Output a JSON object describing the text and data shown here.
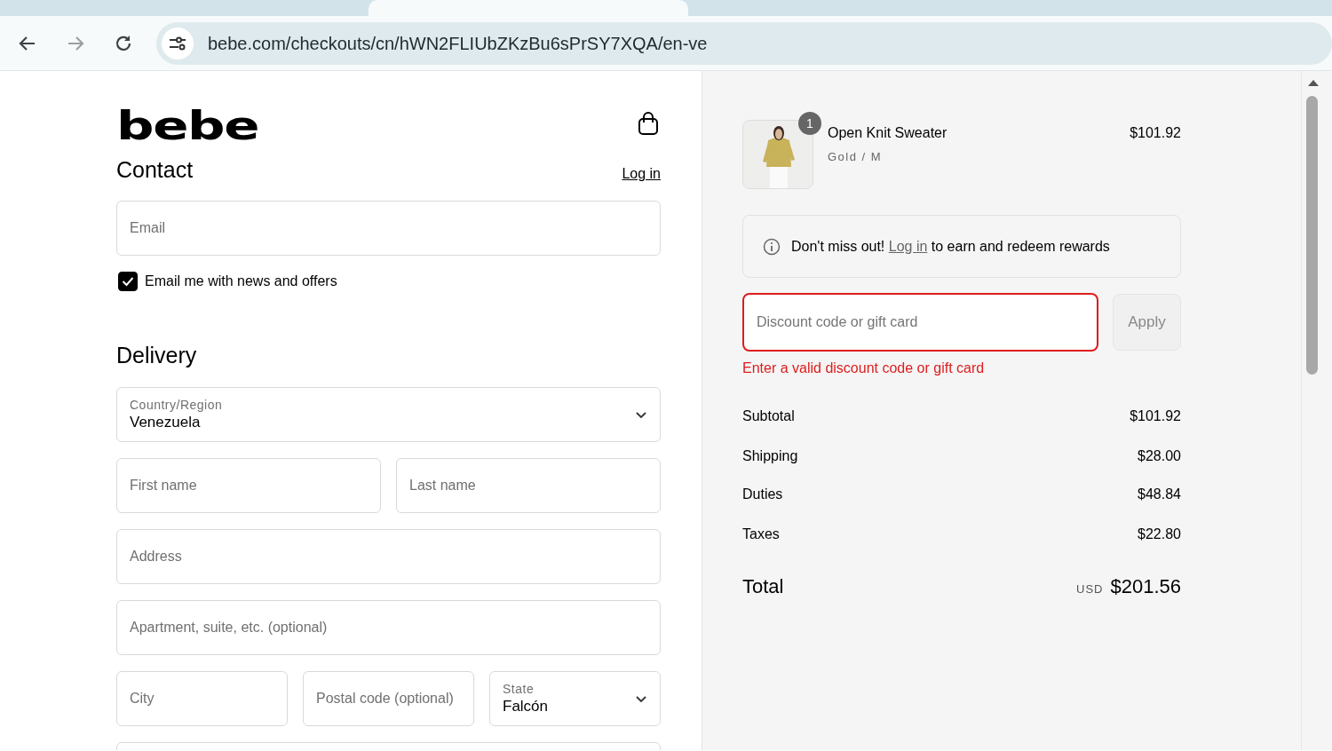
{
  "browser": {
    "url": "bebe.com/checkouts/cn/hWN2FLIUbZKzBu6sPrSY7XQA/en-ve",
    "forward_disabled": true
  },
  "header": {
    "logo": "bebe"
  },
  "contact": {
    "title": "Contact",
    "login_link": "Log in",
    "email": {
      "placeholder": "Email"
    },
    "newsletter": {
      "label": "Email me with news and offers",
      "checked": true
    }
  },
  "delivery": {
    "title": "Delivery",
    "fields": [
      {
        "kind": "select",
        "label": "Country/Region",
        "value": "Venezuela"
      },
      {
        "kind": "pair",
        "items": [
          {
            "placeholder": "First name"
          },
          {
            "placeholder": "Last name"
          }
        ]
      },
      {
        "kind": "input",
        "placeholder": "Address"
      },
      {
        "kind": "input",
        "placeholder": "Apartment, suite, etc. (optional)"
      },
      {
        "kind": "triple",
        "items": [
          {
            "kind": "input",
            "placeholder": "City"
          },
          {
            "kind": "input",
            "placeholder": "Postal code (optional)"
          },
          {
            "kind": "select",
            "label": "State",
            "value": "Falcón"
          }
        ]
      },
      {
        "kind": "input"
      }
    ]
  },
  "summary": {
    "item": {
      "quantity": "1",
      "name": "Open Knit Sweater",
      "variant": "Gold / M",
      "price": "$101.92"
    },
    "notice": {
      "before": "Don't miss out!",
      "link": "Log in",
      "after": "to earn and redeem rewards"
    },
    "discount": {
      "placeholder": "Discount code or gift card",
      "error": true,
      "error_text": "Enter a valid discount code or gift card",
      "apply": "Apply",
      "apply_disabled": true
    },
    "lines": [
      {
        "label": "Subtotal",
        "value": "$101.92"
      },
      {
        "label": "Shipping",
        "value": "$28.00"
      },
      {
        "label": "Duties",
        "value": "$48.84"
      },
      {
        "label": "Taxes",
        "value": "$22.80"
      }
    ],
    "total": {
      "label": "Total",
      "currency": "USD",
      "amount": "$201.56"
    }
  }
}
